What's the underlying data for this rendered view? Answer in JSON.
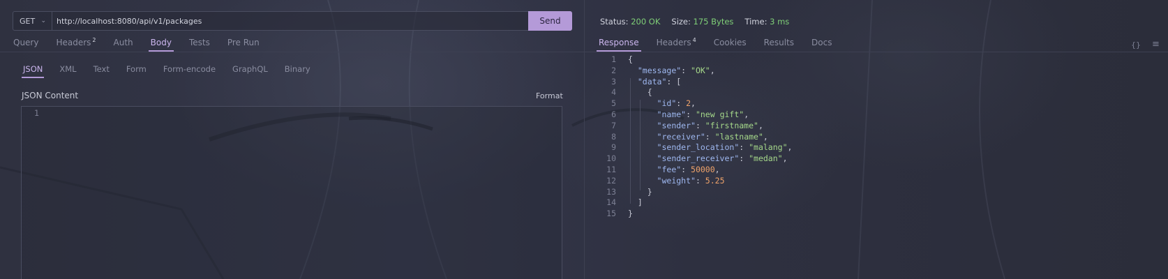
{
  "request": {
    "method": "GET",
    "url": "http://localhost:8080/api/v1/packages",
    "send_label": "Send",
    "tabs": [
      {
        "label": "Query",
        "badge": ""
      },
      {
        "label": "Headers",
        "badge": "2"
      },
      {
        "label": "Auth",
        "badge": ""
      },
      {
        "label": "Body",
        "badge": ""
      },
      {
        "label": "Tests",
        "badge": ""
      },
      {
        "label": "Pre Run",
        "badge": ""
      }
    ],
    "active_tab": "Body",
    "body_types": [
      "JSON",
      "XML",
      "Text",
      "Form",
      "Form-encode",
      "GraphQL",
      "Binary"
    ],
    "active_body_type": "JSON",
    "content_title": "JSON Content",
    "format_label": "Format",
    "editor_line": "1"
  },
  "response": {
    "status_label": "Status:",
    "status_value": "200 OK",
    "size_label": "Size:",
    "size_value": "175 Bytes",
    "time_label": "Time:",
    "time_value": "3 ms",
    "tabs": [
      {
        "label": "Response",
        "badge": ""
      },
      {
        "label": "Headers",
        "badge": "4"
      },
      {
        "label": "Cookies",
        "badge": ""
      },
      {
        "label": "Results",
        "badge": ""
      },
      {
        "label": "Docs",
        "badge": ""
      }
    ],
    "active_tab": "Response",
    "braces_icon": "{}",
    "menu_icon": "≡",
    "code_lines": [
      [
        [
          "p",
          "{"
        ]
      ],
      [
        [
          "p",
          "  "
        ],
        [
          "k",
          "\"message\""
        ],
        [
          "p",
          ": "
        ],
        [
          "s",
          "\"OK\""
        ],
        [
          "p",
          ","
        ]
      ],
      [
        [
          "p",
          "  "
        ],
        [
          "k",
          "\"data\""
        ],
        [
          "p",
          ": ["
        ]
      ],
      [
        [
          "p",
          "    {"
        ]
      ],
      [
        [
          "p",
          "      "
        ],
        [
          "k",
          "\"id\""
        ],
        [
          "p",
          ": "
        ],
        [
          "n",
          "2"
        ],
        [
          "p",
          ","
        ]
      ],
      [
        [
          "p",
          "      "
        ],
        [
          "k",
          "\"name\""
        ],
        [
          "p",
          ": "
        ],
        [
          "s",
          "\"new gift\""
        ],
        [
          "p",
          ","
        ]
      ],
      [
        [
          "p",
          "      "
        ],
        [
          "k",
          "\"sender\""
        ],
        [
          "p",
          ": "
        ],
        [
          "s",
          "\"firstname\""
        ],
        [
          "p",
          ","
        ]
      ],
      [
        [
          "p",
          "      "
        ],
        [
          "k",
          "\"receiver\""
        ],
        [
          "p",
          ": "
        ],
        [
          "s",
          "\"lastname\""
        ],
        [
          "p",
          ","
        ]
      ],
      [
        [
          "p",
          "      "
        ],
        [
          "k",
          "\"sender_location\""
        ],
        [
          "p",
          ": "
        ],
        [
          "s",
          "\"malang\""
        ],
        [
          "p",
          ","
        ]
      ],
      [
        [
          "p",
          "      "
        ],
        [
          "k",
          "\"sender_receiver\""
        ],
        [
          "p",
          ": "
        ],
        [
          "s",
          "\"medan\""
        ],
        [
          "p",
          ","
        ]
      ],
      [
        [
          "p",
          "      "
        ],
        [
          "k",
          "\"fee\""
        ],
        [
          "p",
          ": "
        ],
        [
          "n",
          "50000"
        ],
        [
          "p",
          ","
        ]
      ],
      [
        [
          "p",
          "      "
        ],
        [
          "k",
          "\"weight\""
        ],
        [
          "p",
          ": "
        ],
        [
          "n",
          "5.25"
        ]
      ],
      [
        [
          "p",
          "    }"
        ]
      ],
      [
        [
          "p",
          "  ]"
        ]
      ],
      [
        [
          "p",
          "}"
        ]
      ]
    ]
  }
}
